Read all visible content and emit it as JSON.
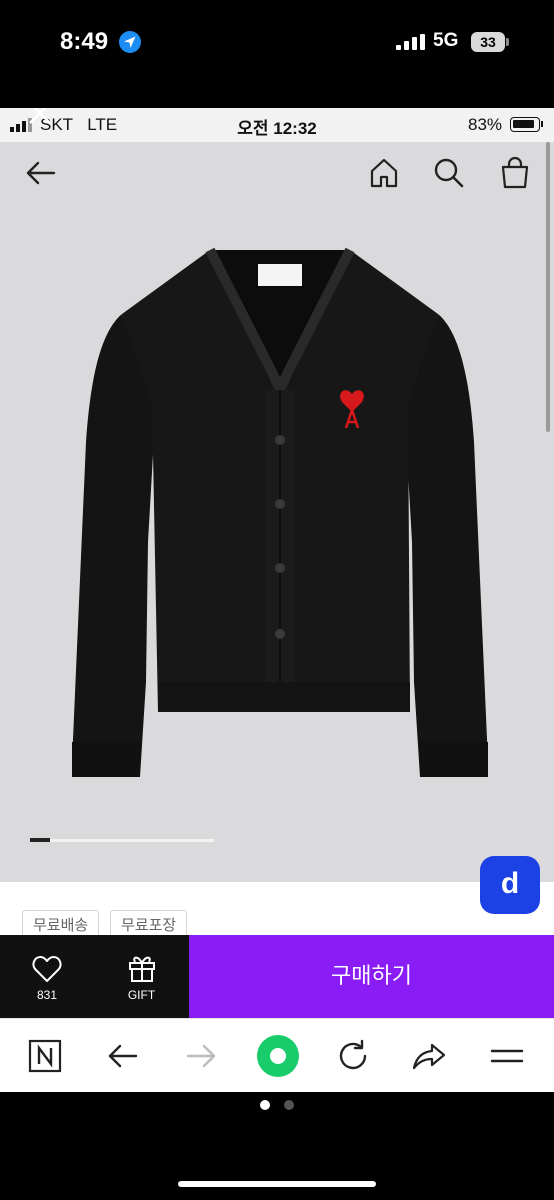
{
  "outer_status": {
    "time": "8:49",
    "network": "5G",
    "battery": "33"
  },
  "inner_status": {
    "carrier": "SKT",
    "network": "LTE",
    "time": "오전 12:32",
    "battery": "83%"
  },
  "top_nav": {
    "icons": [
      "back-arrow-icon",
      "home-icon",
      "search-icon",
      "shopping-bag-icon"
    ]
  },
  "product": {
    "logo_label_text": "AMI",
    "carousel": {
      "current": 1
    }
  },
  "tags": [
    "무료배송",
    "무료포장"
  ],
  "floating_button": {
    "label": "d",
    "color": "#1c42e6"
  },
  "bottom_bar": {
    "wishlist_count": "831",
    "gift_label": "GIFT",
    "buy_label": "구매하기",
    "buy_color": "#8a1cf5"
  },
  "browser_bar": {
    "icons": [
      "naver-n-icon",
      "back-icon",
      "forward-icon",
      "green-dot-icon",
      "refresh-icon",
      "share-icon",
      "menu-icon"
    ]
  },
  "page_dots": {
    "count": 2,
    "active": 0
  }
}
